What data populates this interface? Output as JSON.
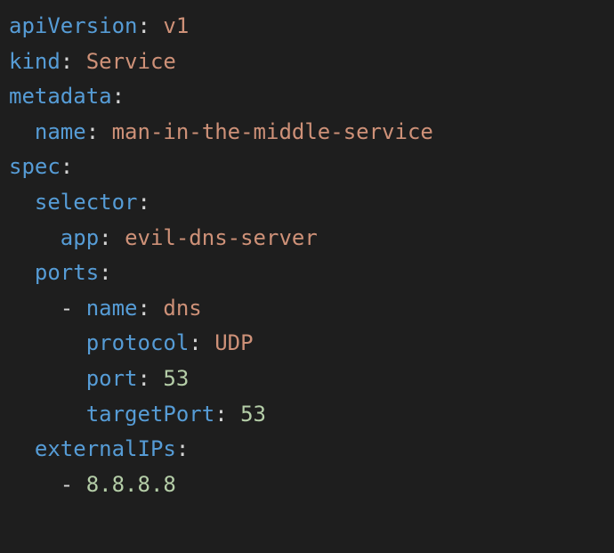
{
  "yaml": {
    "apiVersion_key": "apiVersion",
    "apiVersion_value": "v1",
    "kind_key": "kind",
    "kind_value": "Service",
    "metadata_key": "metadata",
    "metadata_name_key": "name",
    "metadata_name_value": "man-in-the-middle-service",
    "spec_key": "spec",
    "selector_key": "selector",
    "selector_app_key": "app",
    "selector_app_value": "evil-dns-server",
    "ports_key": "ports",
    "port_name_key": "name",
    "port_name_value": "dns",
    "port_protocol_key": "protocol",
    "port_protocol_value": "UDP",
    "port_port_key": "port",
    "port_port_value": "53",
    "port_targetPort_key": "targetPort",
    "port_targetPort_value": "53",
    "externalIPs_key": "externalIPs",
    "externalIPs_value": "8.8.8.8"
  }
}
